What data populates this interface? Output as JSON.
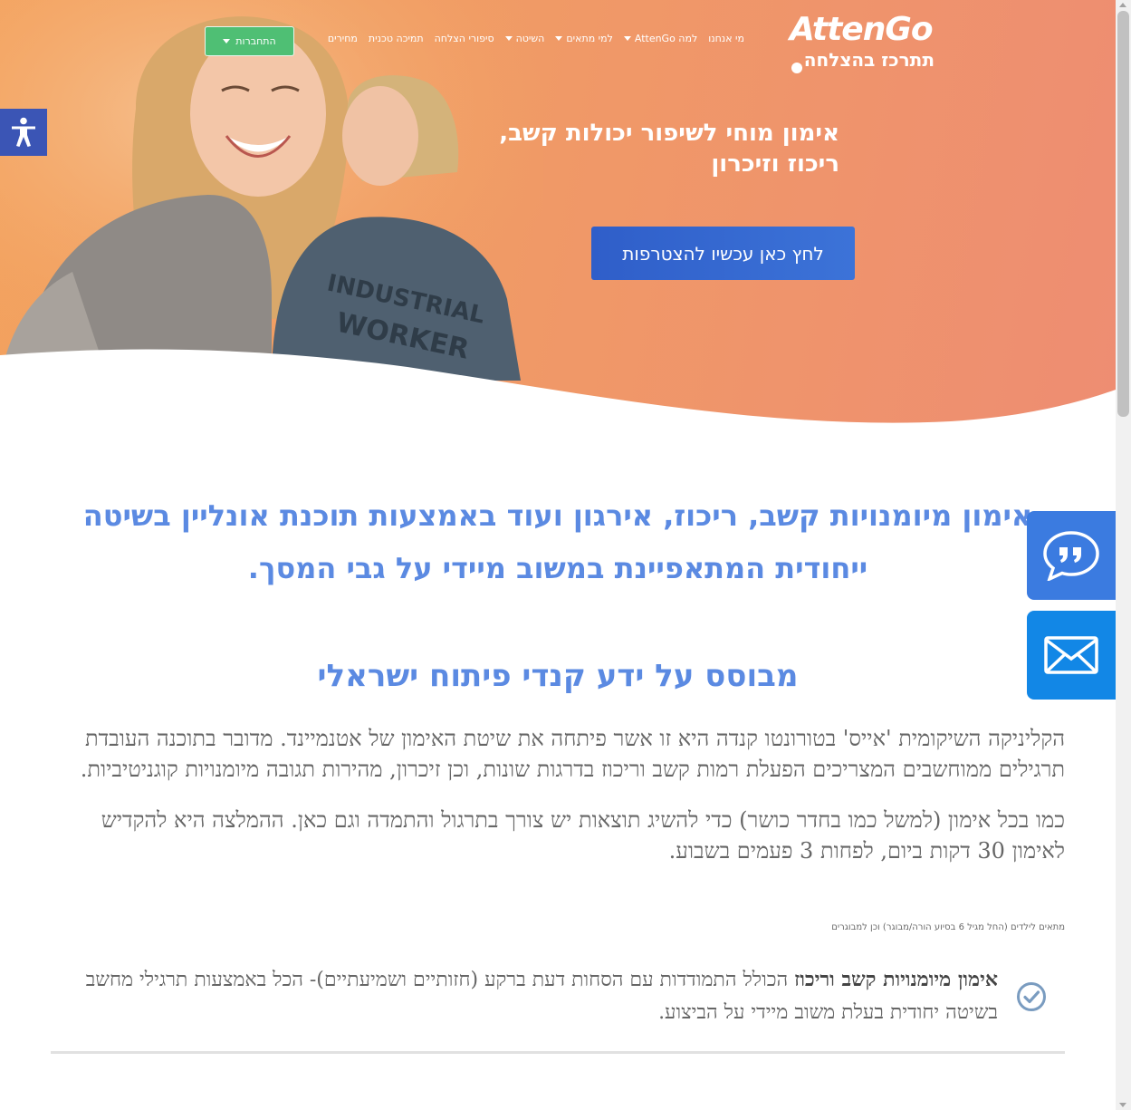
{
  "brand": {
    "logo_text": "AttenGo",
    "tagline": "תתרכז בהצלחה"
  },
  "nav": {
    "items": [
      {
        "label": "מי אנחנו",
        "dropdown": false
      },
      {
        "label": "למה AttenGo",
        "dropdown": true
      },
      {
        "label": "למי מתאים",
        "dropdown": true
      },
      {
        "label": "השיטה",
        "dropdown": true
      },
      {
        "label": "סיפורי הצלחה",
        "dropdown": false
      },
      {
        "label": "תמיכה טכנית",
        "dropdown": false
      },
      {
        "label": "מחירים",
        "dropdown": false
      }
    ],
    "signup_label": "התחברות"
  },
  "hero": {
    "title": "אימון מוחי לשיפור יכולות קשב, ריכוז וזיכרון",
    "cta_label": "לחץ כאן עכשיו להצטרפות"
  },
  "content": {
    "intro": "אימון מיומנויות קשב, ריכוז, אירגון ועוד באמצעות תוכנת אונליין בשיטה ייחודית המתאפיינת במשוב מיידי על גבי המסך.",
    "subheading": "מבוסס על ידע קנדי פיתוח ישראלי",
    "paragraph_1": "הקליניקה השיקומית 'אייס' בטורונטו קנדה היא זו אשר פיתחה את שיטת האימון של אטנמיינד. מדובר בתוכנה העובדת תרגילים ממוחשבים המצריכים הפעלת רמות קשב וריכוז בדרגות שונות, וכן זיכרון, מהירות תגובה מיומנויות קוגניטיביות.",
    "paragraph_2": "כמו בכל אימון (למשל כמו בחדר כושר) כדי להשיג תוצאות יש צורך בתרגול והתמדה וגם כאן. ההמלצה היא להקדיש לאימון 30 דקות ביום, לפחות 3 פעמים בשבוע.",
    "note": "מתאים לילדים (החל מגיל 6 בסיוע הורה/מבוגר) וכן למבוגרים",
    "feature_bold": "אימון מיומנויות קשב וריכוז",
    "feature_rest": " הכולל התמודדות עם הסחות דעת ברקע (חזותיים ושמיעתיים)- הכל באמצעות תרגילי מחשב בשיטה יחודית בעלת משוב מיידי על הביצוע."
  },
  "icons": {
    "accessibility": "accessibility-icon",
    "quote": "quote-bubble-icon",
    "mail": "envelope-icon",
    "check": "check-circle-icon"
  },
  "colors": {
    "hero_start": "#f3a25e",
    "hero_end": "#ee8d72",
    "heading_blue": "#5b8ae2",
    "cta_blue": "#2f5ec9",
    "signup_green": "#4fbf74",
    "accessibility_blue": "#3b55b5",
    "quote_blue": "#3b7be0",
    "mail_blue": "#1287e6"
  }
}
